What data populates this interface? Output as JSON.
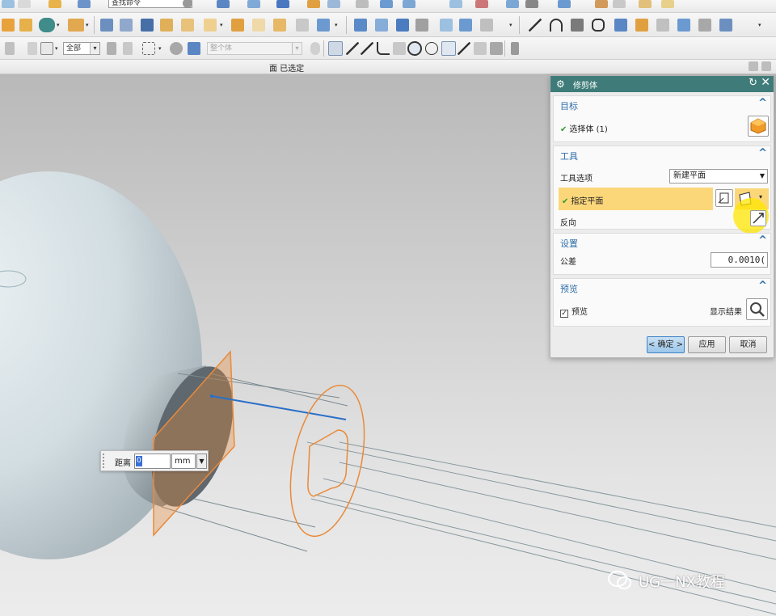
{
  "toolbar": {
    "search_command": "查找命令",
    "filter_value": "全部",
    "selection_scope": "整个体"
  },
  "statusbar": {
    "text": "面 已选定"
  },
  "dialog": {
    "title": "修剪体",
    "target": {
      "header": "目标",
      "select_body_label": "选择体 (1)"
    },
    "tool": {
      "header": "工具",
      "tool_option_label": "工具选项",
      "tool_option_value": "新建平面",
      "specify_plane_label": "指定平面",
      "reverse_label": "反向"
    },
    "settings": {
      "header": "设置",
      "tolerance_label": "公差",
      "tolerance_value": "0.0010("
    },
    "preview": {
      "header": "预览",
      "preview_label": "预览",
      "show_result_label": "显示结果"
    },
    "buttons": {
      "ok": "< 确定 >",
      "apply": "应用",
      "cancel": "取消"
    }
  },
  "distance_widget": {
    "label": "距离",
    "value": "0",
    "unit": "mm"
  },
  "watermark": {
    "text": "UG一NX教程"
  },
  "colors": {
    "dialog_title_bg": "#3f7c79",
    "group_header": "#2f6ea8",
    "highlight_row": "#fcd77a",
    "plane_orange": "#e98a3a",
    "check_green": "#2e9a2e"
  }
}
